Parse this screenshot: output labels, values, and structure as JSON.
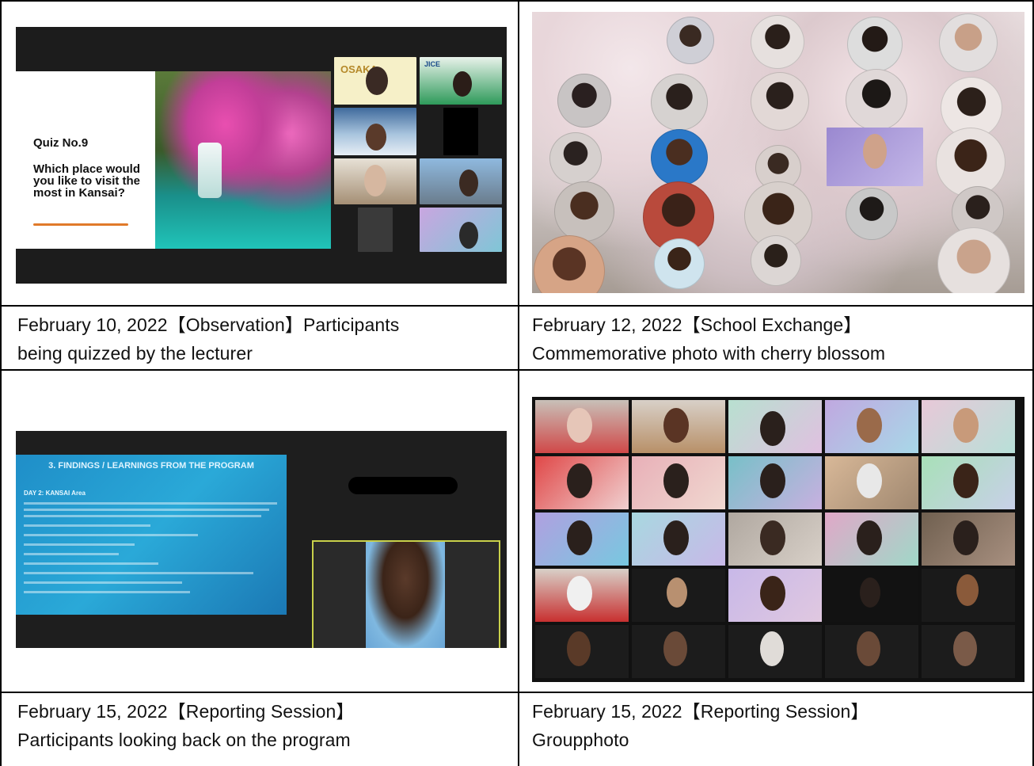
{
  "captions": {
    "c1": {
      "date": "February 10, 2022【Observation】Participants",
      "line2": "being quizzed by the lecturer"
    },
    "c2": {
      "date": "February 12, 2022【School Exchange】",
      "line2": "Commemorative photo with cherry blossom"
    },
    "c3": {
      "date": "February 15, 2022【Reporting Session】",
      "line2": "Participants looking back on the program"
    },
    "c4": {
      "date": "February 15, 2022【Reporting Session】",
      "line2": "Groupphoto"
    }
  },
  "photo1": {
    "quiz_title": "Quiz No.9",
    "quiz_question": "Which place would you like to visit the most in Kansai?",
    "logo_text": "OSAKA",
    "jice_badge": "JICE"
  },
  "photo3": {
    "slide_title": "3. FINDINGS / LEARNINGS FROM THE PROGRAM",
    "slide_sub": "DAY 2: KANSAI Area"
  },
  "colors": {
    "border": "#000000",
    "zoom_bg": "#1c1c1c",
    "accent_underline": "#e07a2a"
  }
}
